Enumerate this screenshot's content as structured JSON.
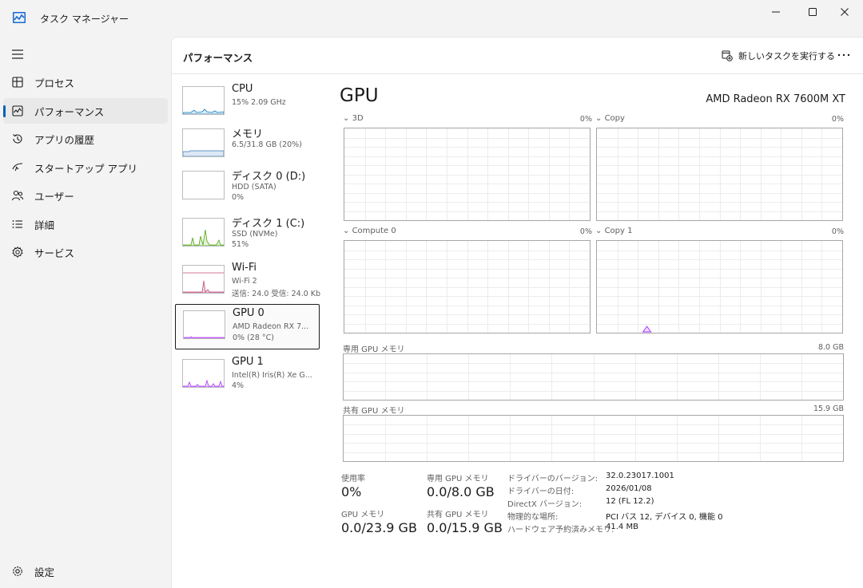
{
  "window": {
    "title": "タスク マネージャー",
    "controls": [
      "minimize",
      "maximize",
      "close"
    ]
  },
  "sidebar": {
    "menu_icon": "hamburger-icon",
    "items": [
      {
        "label": "プロセス",
        "icon": "processes-icon",
        "active": false
      },
      {
        "label": "パフォーマンス",
        "icon": "performance-icon",
        "active": true
      },
      {
        "label": "アプリの履歴",
        "icon": "history-icon",
        "active": false
      },
      {
        "label": "スタートアップ アプリ",
        "icon": "startup-icon",
        "active": false
      },
      {
        "label": "ユーザー",
        "icon": "users-icon",
        "active": false
      },
      {
        "label": "詳細",
        "icon": "details-icon",
        "active": false
      },
      {
        "label": "サービス",
        "icon": "services-icon",
        "active": false
      }
    ],
    "settings_label": "設定"
  },
  "header": {
    "title": "パフォーマンス",
    "run_task_label": "新しいタスクを実行する",
    "more_label": "..."
  },
  "devices": [
    {
      "name": "CPU",
      "line1": "15%  2.09 GHz",
      "line2": "",
      "color": "#117dbb",
      "selected": false
    },
    {
      "name": "メモリ",
      "line1": "6.5/31.8 GB (20%)",
      "line2": "",
      "color": "#3e79b8",
      "selected": false
    },
    {
      "name": "ディスク 0 (D:)",
      "line1": "HDD (SATA)",
      "line2": "0%",
      "color": "#4da60c",
      "selected": false
    },
    {
      "name": "ディスク 1 (C:)",
      "line1": "SSD (NVMe)",
      "line2": "51%",
      "color": "#4da60c",
      "selected": false
    },
    {
      "name": "Wi-Fi",
      "line1": "Wi-Fi 2",
      "line2": "送信: 24.0  受信: 24.0 Kb",
      "color": "#a74f01",
      "selected": false
    },
    {
      "name": "GPU 0",
      "line1": "AMD Radeon RX 7...",
      "line2": "0%  (28 °C)",
      "color": "#ac39ff",
      "selected": true
    },
    {
      "name": "GPU 1",
      "line1": "Intel(R) Iris(R) Xe G...",
      "line2": "4%",
      "color": "#ac39ff",
      "selected": false
    }
  ],
  "detail": {
    "title": "GPU",
    "model": "AMD Radeon RX 7600M XT",
    "engines": [
      {
        "label": "3D",
        "pct": "0%"
      },
      {
        "label": "Copy",
        "pct": "0%"
      },
      {
        "label": "Compute 0",
        "pct": "0%"
      },
      {
        "label": "Copy 1",
        "pct": "0%"
      }
    ],
    "dedicated_memory": {
      "label": "専用 GPU メモリ",
      "max": "8.0 GB"
    },
    "shared_memory": {
      "label": "共有 GPU メモリ",
      "max": "15.9 GB"
    },
    "stats": {
      "usage_label": "使用率",
      "usage_value": "0%",
      "dedicated_label": "専用 GPU メモリ",
      "dedicated_value": "0.0/8.0 GB",
      "gpu_memory_label": "GPU メモリ",
      "gpu_memory_value": "0.0/23.9 GB",
      "shared_label": "共有 GPU メモリ",
      "shared_value": "0.0/15.9 GB"
    },
    "info": [
      {
        "key": "ドライバーのバージョン:",
        "value": "32.0.23017.1001"
      },
      {
        "key": "ドライバーの日付:",
        "value": "2026/01/08"
      },
      {
        "key": "DirectX バージョン:",
        "value": "12 (FL 12.2)"
      },
      {
        "key": "物理的な場所:",
        "value": "PCI バス 12, デバイス 0, 機能 0"
      },
      {
        "key": "ハードウェア予約済みメモリ:",
        "value": "41.4 MB"
      }
    ],
    "accent_color": "#ac39ff"
  }
}
